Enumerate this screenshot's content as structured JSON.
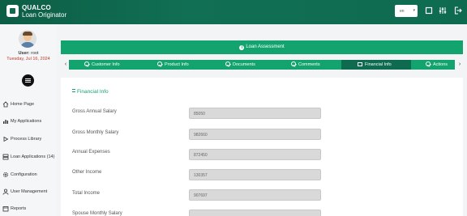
{
  "app": {
    "name_line1": "QUALCO",
    "name_line2": "Loan Originator"
  },
  "toolbar": {
    "language": "en",
    "icons": [
      "square-icon",
      "sliders-icon",
      "logout-icon"
    ]
  },
  "user": {
    "label": "User:",
    "name": "root",
    "date": "Tuesday, Jul 16, 2024"
  },
  "sidebar": {
    "items": [
      {
        "label": "Home Page",
        "icon": "home-icon"
      },
      {
        "label": "My Applications",
        "icon": "bar-chart-icon"
      },
      {
        "label": "Process Library",
        "icon": "play-icon"
      },
      {
        "label": "Loan Applications",
        "badge": "(14)",
        "icon": "server-icon"
      },
      {
        "label": "Configuration",
        "icon": "gear-icon"
      },
      {
        "label": "User Management",
        "icon": "user-icon"
      },
      {
        "label": "Reports",
        "icon": "calendar-icon"
      }
    ]
  },
  "banner": {
    "title": "Loan Assessment"
  },
  "steps": [
    {
      "label": "Customer Info",
      "active": false
    },
    {
      "label": "Product Info",
      "active": false
    },
    {
      "label": "Documents",
      "active": false
    },
    {
      "label": "Comments",
      "active": false
    },
    {
      "label": "Financial Info",
      "active": true
    },
    {
      "label": "Actions",
      "active": false
    }
  ],
  "section": {
    "title": "Financial Info"
  },
  "fields": [
    {
      "label": "Gross Annual Salary",
      "value": "85050"
    },
    {
      "label": "Gross Monthly Salary",
      "value": "982660"
    },
    {
      "label": "Annual Expenses",
      "value": "872450"
    },
    {
      "label": "Other Income",
      "value": "130357"
    },
    {
      "label": "Total Income",
      "value": "907697"
    },
    {
      "label": "Spouse Monthly Salary",
      "value": ""
    }
  ],
  "colors": {
    "header": "#0e6b4f",
    "accent": "#13a36f",
    "active_step": "#0e6b4f",
    "date": "#c0392b"
  }
}
